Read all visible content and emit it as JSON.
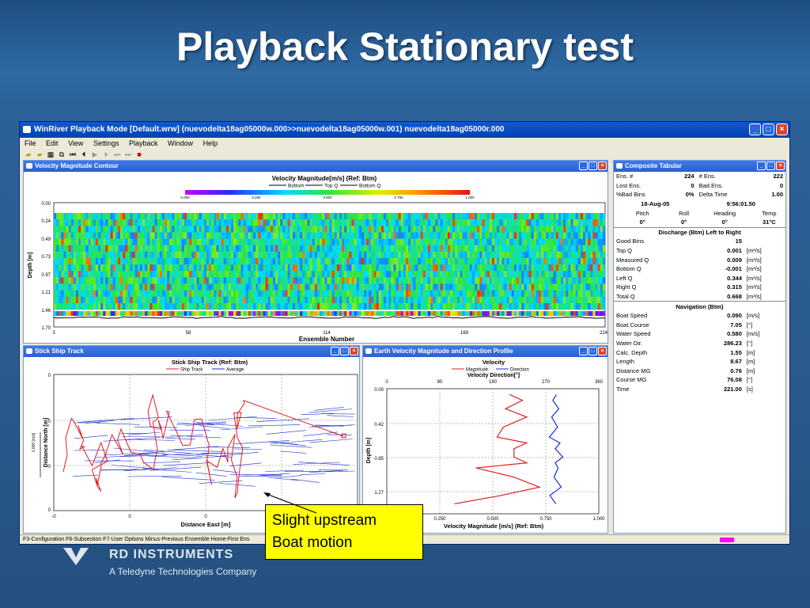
{
  "slide": {
    "title": "Playback Stationary test"
  },
  "app": {
    "title": "WinRiver Playback Mode [Default.wrw] (nuevodelta18ag05000w.000>>nuevodelta18ag05000w.001) nuevodelta18ag05000r.000",
    "menu": [
      "File",
      "Edit",
      "View",
      "Settings",
      "Playback",
      "Window",
      "Help"
    ],
    "status": "F3-Configuration  F6-Subsection  F7-User Options  Minus-Previous Ensemble  Home-First Ens"
  },
  "contour": {
    "window_title": "Velocity Magnitude Contour",
    "chart_title": "Velocity Magnitude[m/s] (Ref: Btm)",
    "legend": [
      "Bottom",
      "Top Q",
      "Bottom Q"
    ],
    "scale_ticks": [
      "0.000",
      "0.250",
      "0.500",
      "0.750",
      "1.000"
    ],
    "y_ticks": [
      "0.00",
      "0.24",
      "0.49",
      "0.73",
      "0.97",
      "1.21",
      "1.46",
      "1.70"
    ],
    "x_ticks": [
      "3",
      "58",
      "114",
      "169",
      "224"
    ],
    "ylabel": "Depth [m]",
    "xlabel": "Ensemble Number"
  },
  "shiptrack": {
    "window_title": "Stick Ship Track",
    "chart_title": "Stick Ship Track (Ref: Btm)",
    "legend": [
      "Ship Track",
      "Average"
    ],
    "y_ticks": [
      "0",
      "0",
      "0",
      "0",
      "-0"
    ],
    "x_ticks": [
      "-0",
      "0",
      "0",
      "0",
      "0"
    ],
    "scale_label": "1.000 [m/s]",
    "ylabel": "Distance North [m]",
    "xlabel": "Distance East [m]"
  },
  "profile": {
    "window_title": "Earth Velocity Magnitude and Direction Profile",
    "chart_title": "Velocity",
    "legend": [
      "Magnitude",
      "Direction"
    ],
    "top_axis_title": "Velocity Direction[°]",
    "top_ticks": [
      "0",
      "90",
      "180",
      "270",
      "360"
    ],
    "y_ticks": [
      "0.00",
      "0.42",
      "0.85",
      "1.27"
    ],
    "bottom_ticks": [
      "0.250",
      "0.500",
      "0.750",
      "1.000"
    ],
    "ylabel": "Depth [m]",
    "xlabel": "Velocity Magnitude [m/s] (Ref: Btm)"
  },
  "tabular": {
    "window_title": "Composite Tabular",
    "rows_a": [
      [
        "Ens. #",
        "224",
        "# Ens.",
        "222"
      ],
      [
        "Lost Ens.",
        "0",
        "Bad Ens.",
        "0"
      ],
      [
        "%Bad Bins",
        "0%",
        "Delta Time",
        "1.00"
      ]
    ],
    "date": "18-Aug-05",
    "time": "9:56:01.50",
    "orient_headers": [
      "Pitch",
      "Roll",
      "Heading",
      "Temp"
    ],
    "orient_values": [
      "0°",
      "0°",
      "0°",
      "31°C"
    ],
    "discharge_title": "Discharge (Btm) Left to Right",
    "discharge": [
      [
        "Good Bins",
        "15",
        ""
      ],
      [
        "Top Q",
        "0.001",
        "[m³/s]"
      ],
      [
        "Measured Q",
        "0.009",
        "[m³/s]"
      ],
      [
        "Bottom Q",
        "-0.001",
        "[m³/s]"
      ],
      [
        "Left Q",
        "0.344",
        "[m³/s]"
      ],
      [
        "Right Q",
        "0.315",
        "[m³/s]"
      ],
      [
        "Total Q",
        "0.668",
        "[m³/s]"
      ]
    ],
    "nav_title": "Navigation (Btm)",
    "navigation": [
      [
        "Boat Speed",
        "0.090",
        "[m/s]"
      ],
      [
        "Boat Course",
        "7.05",
        "[°]"
      ],
      [
        "Water Speed",
        "0.580",
        "[m/s]"
      ],
      [
        "Water Dir.",
        "286.23",
        "[°]"
      ],
      [
        "Calc. Depth",
        "1.55",
        "[m]"
      ],
      [
        "Length",
        "8.67",
        "[m]"
      ],
      [
        "Distance MG",
        "0.76",
        "[m]"
      ],
      [
        "Course MG",
        "76.08",
        "[°]"
      ],
      [
        "Time",
        "221.00",
        "[s]"
      ]
    ]
  },
  "callout": {
    "line1": "Slight upstream",
    "line2": "Boat motion"
  },
  "logo": {
    "name": "RD INSTRUMENTS",
    "sub": "A Teledyne Technologies Company"
  },
  "colors": {
    "magnitude": "#e02020",
    "direction": "#1a2ecc",
    "callout": "#ffff00"
  },
  "chart_data": [
    {
      "type": "line",
      "title": "Velocity",
      "series": [
        {
          "name": "Magnitude",
          "x": [
            0.58,
            0.64,
            0.56,
            0.66,
            0.55,
            0.52,
            0.66,
            0.6,
            0.6,
            0.66,
            0.42,
            0.6,
            0.72,
            0.54,
            0.32
          ],
          "y": [
            0.07,
            0.14,
            0.24,
            0.34,
            0.46,
            0.58,
            0.65,
            0.72,
            0.82,
            0.89,
            0.95,
            1.06,
            1.18,
            1.28,
            1.38
          ]
        },
        {
          "name": "Direction",
          "x": [
            288,
            282,
            292,
            280,
            290,
            276,
            294,
            286,
            299,
            286,
            291,
            284,
            296,
            277,
            287
          ],
          "y": [
            0.07,
            0.14,
            0.24,
            0.34,
            0.46,
            0.58,
            0.65,
            0.72,
            0.82,
            0.89,
            0.95,
            1.06,
            1.18,
            1.28,
            1.38
          ]
        }
      ],
      "xlabel": "Velocity Magnitude [m/s] (Ref: Btm)",
      "ylabel": "Depth [m]",
      "xlim": [
        0.25,
        1.0
      ],
      "ylim": [
        1.5,
        0
      ],
      "top_xlim": [
        0,
        360
      ]
    }
  ]
}
